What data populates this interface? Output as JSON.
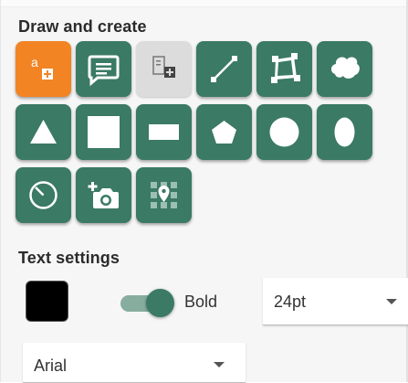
{
  "draw_section": {
    "title": "Draw and create",
    "tools": [
      {
        "name": "add-text-tool",
        "icon": "text-plus-icon",
        "state": "active",
        "glyph": "a"
      },
      {
        "name": "speech-bubble-tool",
        "icon": "speech-bubble-icon",
        "state": "normal"
      },
      {
        "name": "text-field-tool",
        "icon": "text-field-plus-icon",
        "state": "disabled"
      },
      {
        "name": "line-tool",
        "icon": "line-icon",
        "state": "normal"
      },
      {
        "name": "polygon-edit-tool",
        "icon": "polygon-vertices-icon",
        "state": "normal"
      },
      {
        "name": "freeform-shape-tool",
        "icon": "cloud-shape-icon",
        "state": "normal"
      },
      {
        "name": "triangle-tool",
        "icon": "triangle-icon",
        "state": "normal"
      },
      {
        "name": "square-tool",
        "icon": "square-icon",
        "state": "normal"
      },
      {
        "name": "rectangle-tool",
        "icon": "rectangle-icon",
        "state": "normal"
      },
      {
        "name": "pentagon-tool",
        "icon": "pentagon-icon",
        "state": "normal"
      },
      {
        "name": "circle-tool",
        "icon": "circle-icon",
        "state": "normal"
      },
      {
        "name": "ellipse-tool",
        "icon": "ellipse-icon",
        "state": "normal"
      },
      {
        "name": "circle-radius-tool",
        "icon": "circle-radius-icon",
        "state": "normal"
      },
      {
        "name": "add-photo-tool",
        "icon": "camera-plus-icon",
        "state": "normal"
      },
      {
        "name": "map-grid-pin-tool",
        "icon": "grid-pin-icon",
        "state": "normal"
      }
    ]
  },
  "text_settings": {
    "title": "Text settings",
    "color": "#000000",
    "bold_label": "Bold",
    "bold_enabled": true,
    "size_value": "24pt",
    "font_value": "Arial"
  },
  "colors": {
    "accent": "#3b7a65",
    "active": "#f28424",
    "disabled": "#dcdcdc"
  }
}
